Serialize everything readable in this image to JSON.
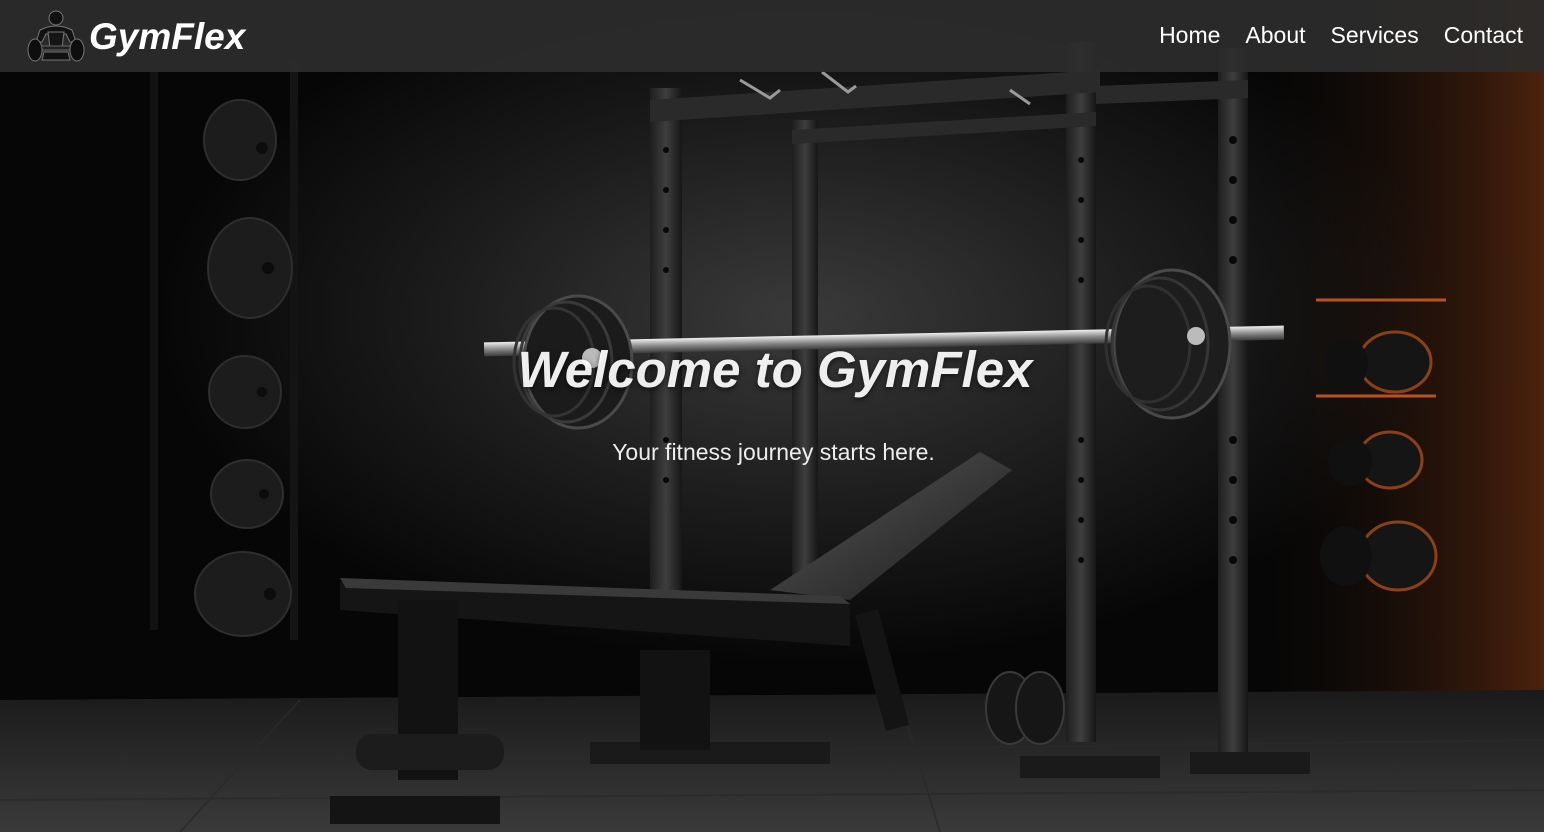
{
  "navbar": {
    "brand": {
      "name": "GymFlex",
      "logo_icon": "weightlifter-icon"
    },
    "links": [
      {
        "label": "Home"
      },
      {
        "label": "About"
      },
      {
        "label": "Services"
      },
      {
        "label": "Contact"
      }
    ]
  },
  "hero": {
    "title": "Welcome to GymFlex",
    "subtitle": "Your fitness journey starts here.",
    "background_image": "gym-power-rack-bench-photo"
  },
  "colors": {
    "navbar_bg": "#2d2d2d",
    "text": "#ffffff",
    "accent_orange": "#c0521c"
  }
}
